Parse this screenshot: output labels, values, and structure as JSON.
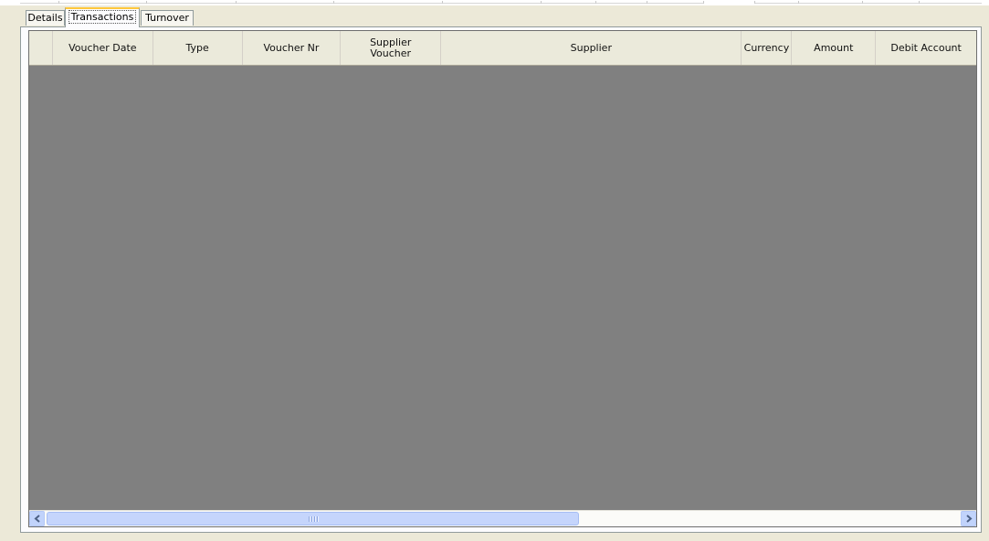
{
  "tabs": [
    {
      "label": "Details",
      "active": false
    },
    {
      "label": "Transactions",
      "active": true
    },
    {
      "label": "Turnover",
      "active": false
    }
  ],
  "grid": {
    "columns": [
      {
        "label": ""
      },
      {
        "label": "Voucher Date"
      },
      {
        "label": "Type"
      },
      {
        "label": "Voucher Nr"
      },
      {
        "label": "Supplier\nVoucher"
      },
      {
        "label": "Supplier"
      },
      {
        "label": "Currency"
      },
      {
        "label": "Amount"
      },
      {
        "label": "Debit Account"
      }
    ],
    "rows": []
  },
  "scrollbar": {
    "left_icon": "arrow-left-icon",
    "right_icon": "arrow-right-icon",
    "thumb_grip_icon": "grip-icon"
  },
  "colors": {
    "active_tab_accent": "#ffc83c",
    "grid_empty_background": "#808080",
    "header_background": "#ebeadb",
    "window_background": "#ece9d8"
  }
}
